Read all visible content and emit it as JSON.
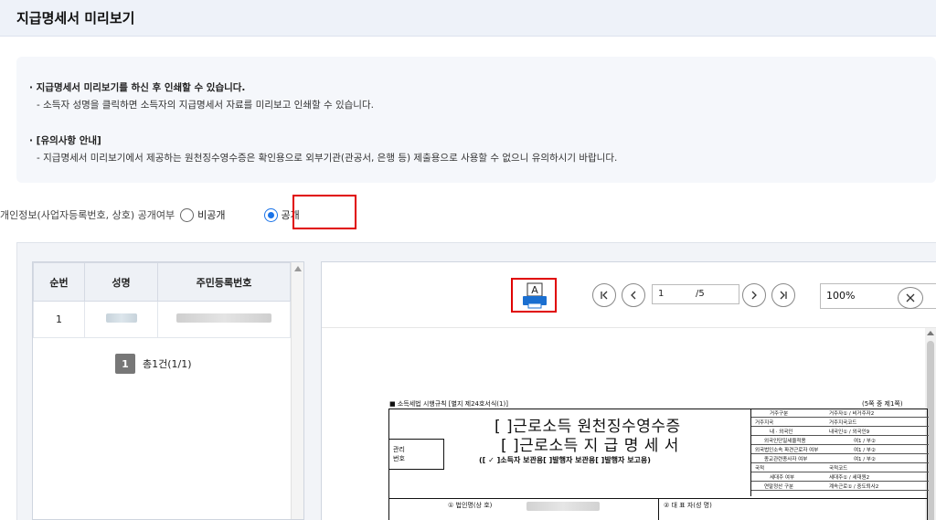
{
  "page": {
    "title": "지급명세서 미리보기"
  },
  "notice": {
    "l1": "· 지급명세서 미리보기를 하신 후 인쇄할 수 있습니다.",
    "l2": "- 소득자 성명을 클릭하면 소득자의 지급명세서 자료를 미리보고 인쇄할 수 있습니다.",
    "l3": "· [유의사항 안내]",
    "l4": "- 지급명세서 미리보기에서 제공하는 원천징수영수증은 확인용으로 외부기관(관공서, 은행 등) 제출용으로 사용할 수 없으니 유의하시기 바랍니다."
  },
  "privacy": {
    "label": "개인정보(사업자등록번호, 상호) 공개여부",
    "opt_private": "비공개",
    "opt_public": "공개",
    "selected": "공개"
  },
  "list": {
    "headers": [
      "순번",
      "성명",
      "주민등록번호"
    ],
    "rows": [
      {
        "no": "1"
      }
    ],
    "page_badge": "1",
    "total": "총1건(1/1)"
  },
  "viewer": {
    "page_current": "1",
    "page_total": "/5",
    "zoom": "100%",
    "print_icon_letter": "A",
    "accent": "#1a6fd0"
  },
  "doc": {
    "header_left": "■ 소득세법 시행규칙 [별지 제24호서식(1)]",
    "header_right": "(5쪽 중 제1쪽)",
    "title1": "[ ]근로소득 원천징수영수증",
    "title2": "[ ]근로소득 지 급 명 세 서",
    "subtitle": "([ ✓ ]소득자 보관용[   ]발행자 보관용[   ]발행자 보고용)",
    "mgmt_label1": "관리",
    "mgmt_label2": "번호",
    "bottom_left": "① 법인명(상 호)",
    "bottom_right": "② 대 표 자(성 명)",
    "grid": [
      [
        "거주구분",
        "거주자① / 비거주자2"
      ],
      [
        "거주지국",
        "거주지국코드"
      ],
      [
        "내 · 외국인",
        "내국인① / 외국인9"
      ],
      [
        "외국인단일세율적용",
        "여1 / 부②"
      ],
      [
        "외국법인소속 파견근로자 여부",
        "여1 / 부②"
      ],
      [
        "종교관련종사자 여부",
        "여1 / 부②"
      ],
      [
        "국적",
        "국적코드"
      ],
      [
        "세대주 여부",
        "세대주① / 세대원2"
      ],
      [
        "연말정산 구분",
        "계속근로① / 중도퇴사2"
      ]
    ]
  }
}
